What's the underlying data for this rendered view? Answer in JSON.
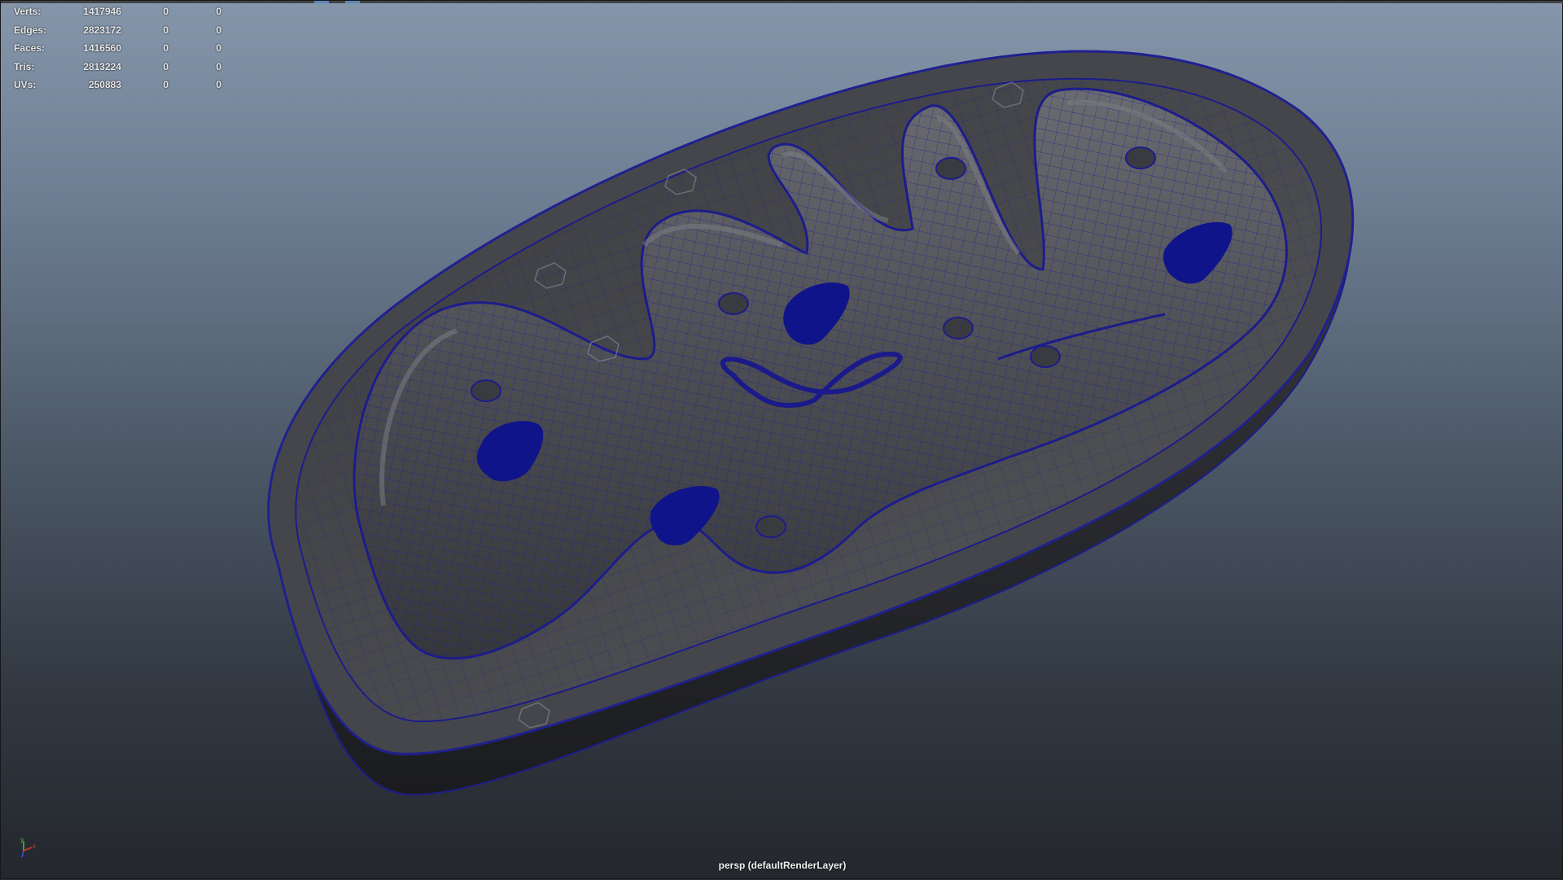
{
  "hud": {
    "rows": [
      {
        "label": "Verts:",
        "total": "1417946",
        "selected": "0",
        "triangles": "0"
      },
      {
        "label": "Edges:",
        "total": "2823172",
        "selected": "0",
        "triangles": "0"
      },
      {
        "label": "Faces:",
        "total": "1416560",
        "selected": "0",
        "triangles": "0"
      },
      {
        "label": "Tris:",
        "total": "2813224",
        "selected": "0",
        "triangles": "0"
      },
      {
        "label": "UVs:",
        "total": "250883",
        "selected": "0",
        "triangles": "0"
      }
    ]
  },
  "camera_label": "persp (defaultRenderLayer)",
  "axis_labels": {
    "x": "x",
    "y": "y"
  },
  "colors": {
    "wireframe": "#1c1c8c",
    "mesh_shade": "#4a4a4d",
    "protein": "#10148a",
    "axis_x": "#e03030",
    "axis_y": "#3ad03a",
    "axis_z": "#3a5ae8"
  },
  "scene": {
    "object": "mitochondrion-mesh",
    "shading": "wireframe-on-shaded"
  }
}
